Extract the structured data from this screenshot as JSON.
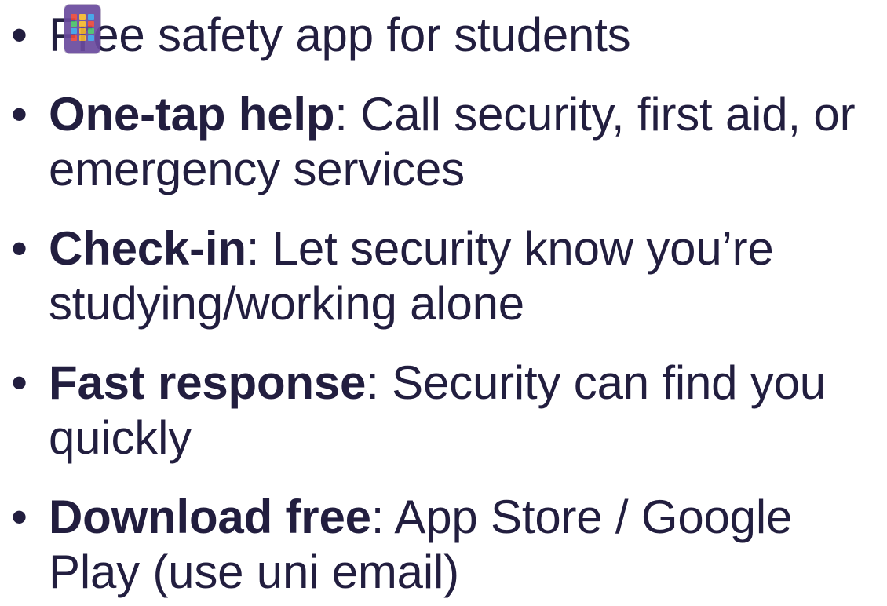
{
  "slide": {
    "bullet_char": "•",
    "bullets": [
      {
        "strong": "",
        "sep": "",
        "text": "Free safety app for students"
      },
      {
        "strong": "One-tap help",
        "sep": ": ",
        "text": "Call security, first aid, or emergency services"
      },
      {
        "strong": "Check-in",
        "sep": ": ",
        "text": "Let security know you’re studying/working alone"
      },
      {
        "strong": "Fast response",
        "sep": ": ",
        "text": "Security can find you quickly"
      },
      {
        "strong": "Download free",
        "sep": ": ",
        "text": "App Store / Google Play (use uni email)"
      }
    ]
  },
  "app_icon": {
    "name": "app-launcher-icon",
    "colors": {
      "background": "#6a4a9e",
      "tiles": [
        "#e8483b",
        "#f5b82e",
        "#3aa0e8",
        "#49c06a",
        "#f5b82e",
        "#e8483b",
        "#3aa0e8",
        "#f5b82e",
        "#49c06a",
        "#e8483b",
        "#f5b82e",
        "#3aa0e8"
      ]
    }
  },
  "colors": {
    "text": "#221e3f",
    "background": "#ffffff"
  }
}
